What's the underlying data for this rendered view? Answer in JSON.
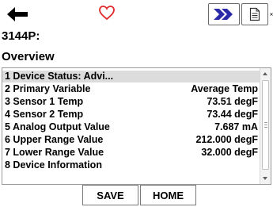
{
  "toolbar": {
    "icons": [
      "back-arrow-icon",
      "heart-icon",
      "hot-key-chevron-icon",
      "document-icon",
      "close-icon"
    ],
    "accent_heart": "#e0282a",
    "accent_hotkey": "#2a2aa8"
  },
  "header": {
    "title_line1": "3144P:",
    "title_line2": "Overview"
  },
  "menu": {
    "items": [
      {
        "label": "1 Device Status: Advi...",
        "value": ""
      },
      {
        "label": "2 Primary Variable",
        "value": "Average Temp"
      },
      {
        "label": "3 Sensor 1 Temp",
        "value": "73.51 degF"
      },
      {
        "label": "4 Sensor 2 Temp",
        "value": "73.44 degF"
      },
      {
        "label": "5 Analog Output Value",
        "value": "7.687 mA"
      },
      {
        "label": "6 Upper Range Value",
        "value": "212.000 degF"
      },
      {
        "label": "7 Lower Range Value",
        "value": "32.000 degF"
      },
      {
        "label": "8 Device Information",
        "value": ""
      }
    ]
  },
  "footer": {
    "save_label": "SAVE",
    "home_label": "HOME"
  }
}
